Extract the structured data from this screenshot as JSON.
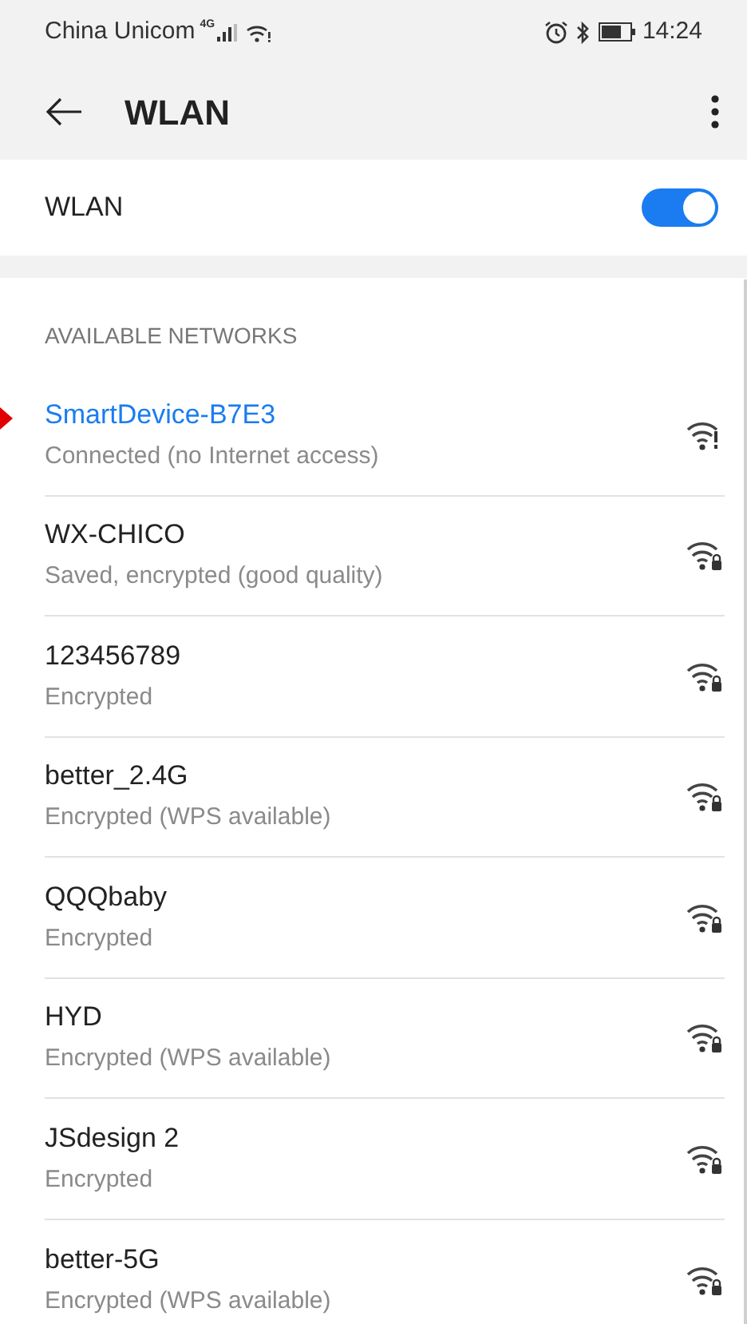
{
  "status_bar": {
    "carrier": "China Unicom",
    "network_type": "4G",
    "time": "14:24"
  },
  "toolbar": {
    "title": "WLAN"
  },
  "wlan_switch": {
    "label": "WLAN",
    "on": true
  },
  "section_title": "AVAILABLE NETWORKS",
  "networks": [
    {
      "name": "SmartDevice-B7E3",
      "status": "Connected (no Internet access)",
      "connected": true,
      "locked": false,
      "warning": true
    },
    {
      "name": "WX-CHICO",
      "status": "Saved, encrypted (good quality)",
      "connected": false,
      "locked": true,
      "warning": false
    },
    {
      "name": "123456789",
      "status": "Encrypted",
      "connected": false,
      "locked": true,
      "warning": false
    },
    {
      "name": "better_2.4G",
      "status": "Encrypted (WPS available)",
      "connected": false,
      "locked": true,
      "warning": false
    },
    {
      "name": "QQQbaby",
      "status": "Encrypted",
      "connected": false,
      "locked": true,
      "warning": false
    },
    {
      "name": "HYD",
      "status": "Encrypted (WPS available)",
      "connected": false,
      "locked": true,
      "warning": false
    },
    {
      "name": "JSdesign 2",
      "status": "Encrypted",
      "connected": false,
      "locked": true,
      "warning": false
    },
    {
      "name": "better-5G",
      "status": "Encrypted (WPS available)",
      "connected": false,
      "locked": true,
      "warning": false
    }
  ]
}
